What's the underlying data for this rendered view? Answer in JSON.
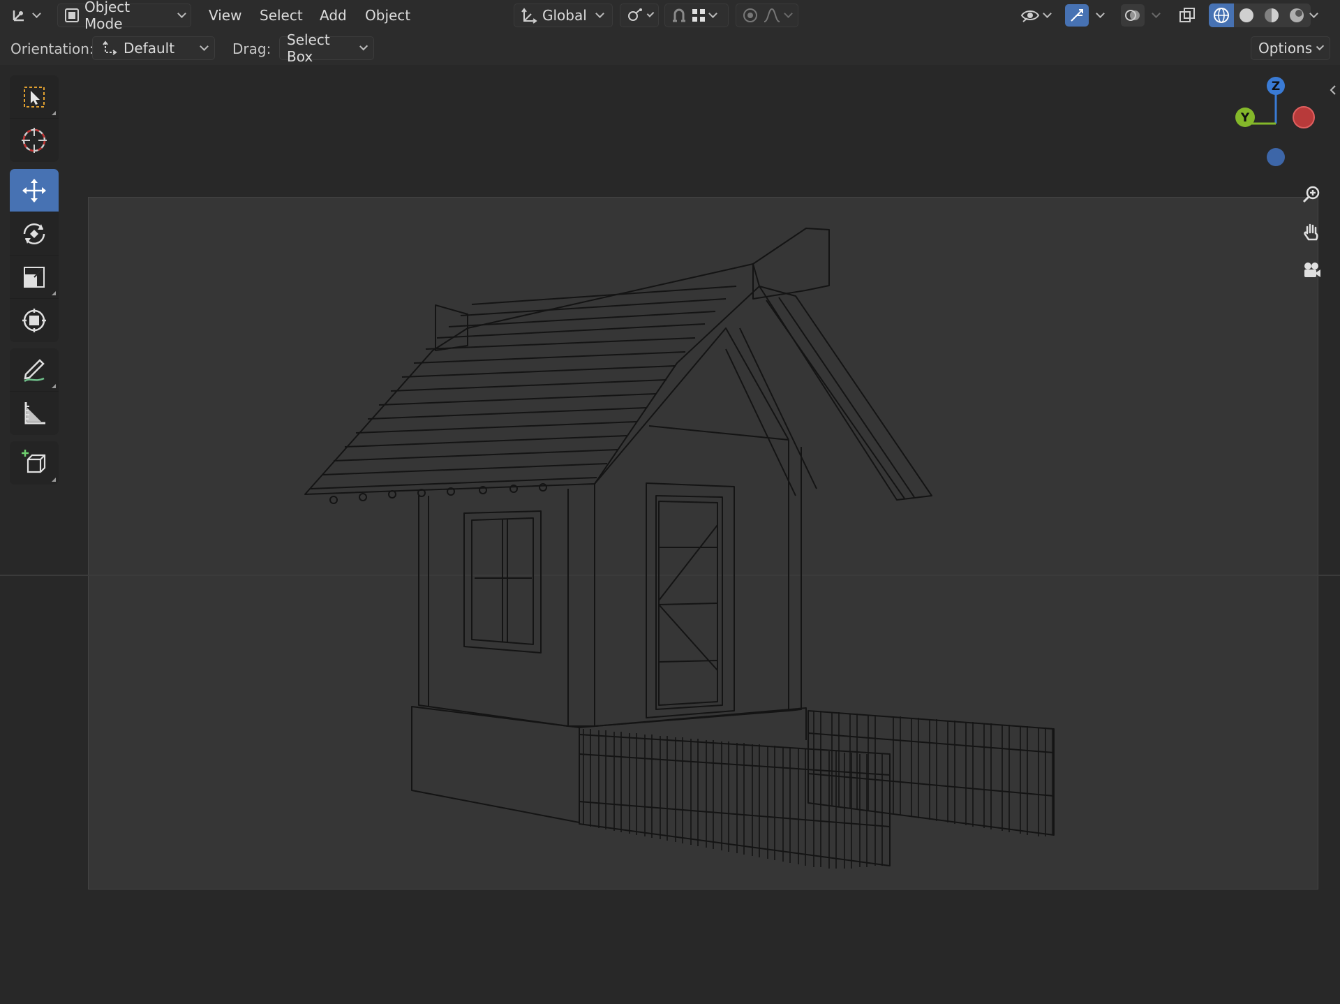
{
  "header": {
    "mode_label": "Object Mode",
    "menus": [
      "View",
      "Select",
      "Add",
      "Object"
    ],
    "transform_orientation": "Global"
  },
  "tool_settings": {
    "orientation_label": "Orientation:",
    "orientation_value": "Default",
    "drag_label": "Drag:",
    "drag_value": "Select Box",
    "options_label": "Options"
  },
  "gizmo": {
    "z_label": "Z",
    "y_label": "Y"
  },
  "colors": {
    "accent": "#4772b3",
    "axis_x": "#e05c5c",
    "axis_y": "#84b82a",
    "axis_z": "#3a7bd5"
  },
  "toolbar": {
    "tools": [
      "select-box",
      "cursor",
      "move",
      "rotate",
      "scale",
      "transform",
      "annotate",
      "measure",
      "add-cube"
    ],
    "active_tool": "move"
  }
}
